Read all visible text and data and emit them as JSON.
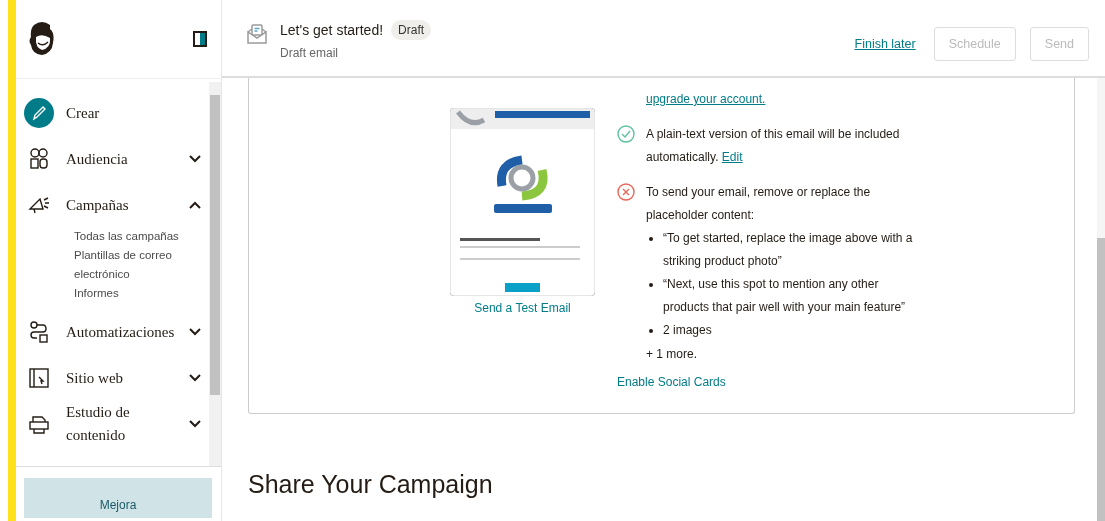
{
  "sidebar": {
    "items": [
      {
        "label": "Crear",
        "kind": "create"
      },
      {
        "label": "Audiencia",
        "kind": "audience",
        "expanded": false
      },
      {
        "label": "Campañas",
        "kind": "campaigns",
        "expanded": true,
        "children": [
          {
            "label": "Todas las campañas"
          },
          {
            "label": "Plantillas de correo electrónico"
          },
          {
            "label": "Informes"
          }
        ]
      },
      {
        "label": "Automatizaciones",
        "kind": "automations",
        "expanded": false
      },
      {
        "label": "Sitio web",
        "kind": "website",
        "expanded": false
      },
      {
        "label": "Estudio de contenido",
        "kind": "studio",
        "expanded": false
      }
    ],
    "upgrade_button": "Mejora"
  },
  "header": {
    "title": "Let's get started!",
    "badge": "Draft",
    "subtitle": "Draft email",
    "finish_later": "Finish later",
    "buttons": [
      {
        "label": "Schedule",
        "disabled": true
      },
      {
        "label": "Send",
        "disabled": true
      }
    ]
  },
  "preview": {
    "test_link": "Send a Test Email"
  },
  "checks": [
    {
      "kind": "partial",
      "link": "upgrade your account."
    },
    {
      "kind": "ok",
      "text": "A plain-text version of this email will be included automatically.",
      "link": "Edit"
    },
    {
      "kind": "error",
      "text": "To send your email, remove or replace the placeholder content:",
      "bullets": [
        "“To get started, replace the image above with a striking product photo”",
        "“Next, use this spot to mention any other products that pair well with your main feature”",
        "2 images"
      ],
      "more": "+ 1 more."
    }
  ],
  "social_link": "Enable Social Cards",
  "section_title": "Share Your Campaign"
}
